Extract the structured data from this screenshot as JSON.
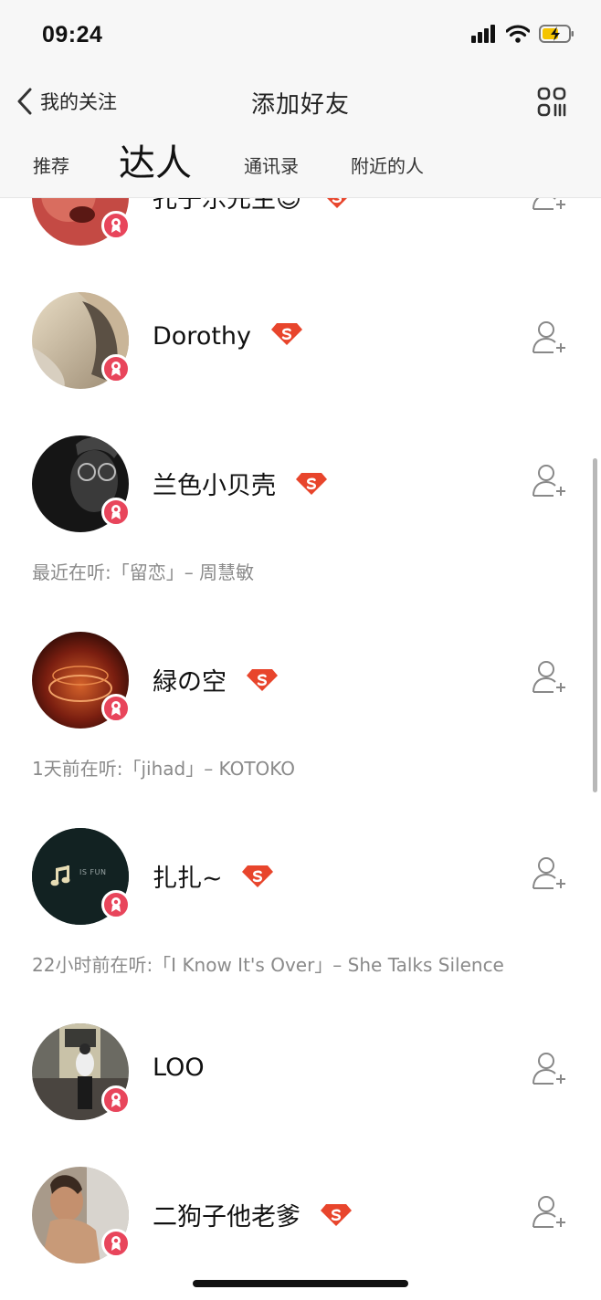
{
  "status_bar": {
    "time": "09:24",
    "icons": [
      "signal-icon",
      "wifi-icon",
      "battery-charging-icon"
    ],
    "battery_color": "#f5c400"
  },
  "nav": {
    "back_label": "我的关注",
    "title": "添加好友",
    "right_icon": "qr-scan-icon"
  },
  "tabs": [
    {
      "label": "推荐",
      "active": false
    },
    {
      "label": "达人",
      "active": true
    },
    {
      "label": "通讯录",
      "active": false
    },
    {
      "label": "附近的人",
      "active": false
    }
  ],
  "users": [
    {
      "name": "孔子乐先生☺",
      "svip": true,
      "listening": ""
    },
    {
      "name": "Dorothy",
      "svip": true,
      "listening": ""
    },
    {
      "name": "兰色小贝壳",
      "svip": true,
      "listening": "最近在听:「留恋」– 周慧敏"
    },
    {
      "name": "緑の空",
      "svip": true,
      "listening": "1天前在听:「jihad」– KOTOKO"
    },
    {
      "name": "扎扎~",
      "svip": true,
      "listening": "22小时前在听:「I Know It's Over」– She Talks Silence"
    },
    {
      "name": "LOO",
      "svip": false,
      "listening": ""
    },
    {
      "name": "二狗子他老爹",
      "svip": true,
      "listening": ""
    }
  ],
  "avatar_texts": {
    "zhazha": "IS FUN"
  },
  "colors": {
    "accent_red": "#e8455b",
    "svip_badge": "#e8452c",
    "secondary_text": "#8a8a8a"
  }
}
